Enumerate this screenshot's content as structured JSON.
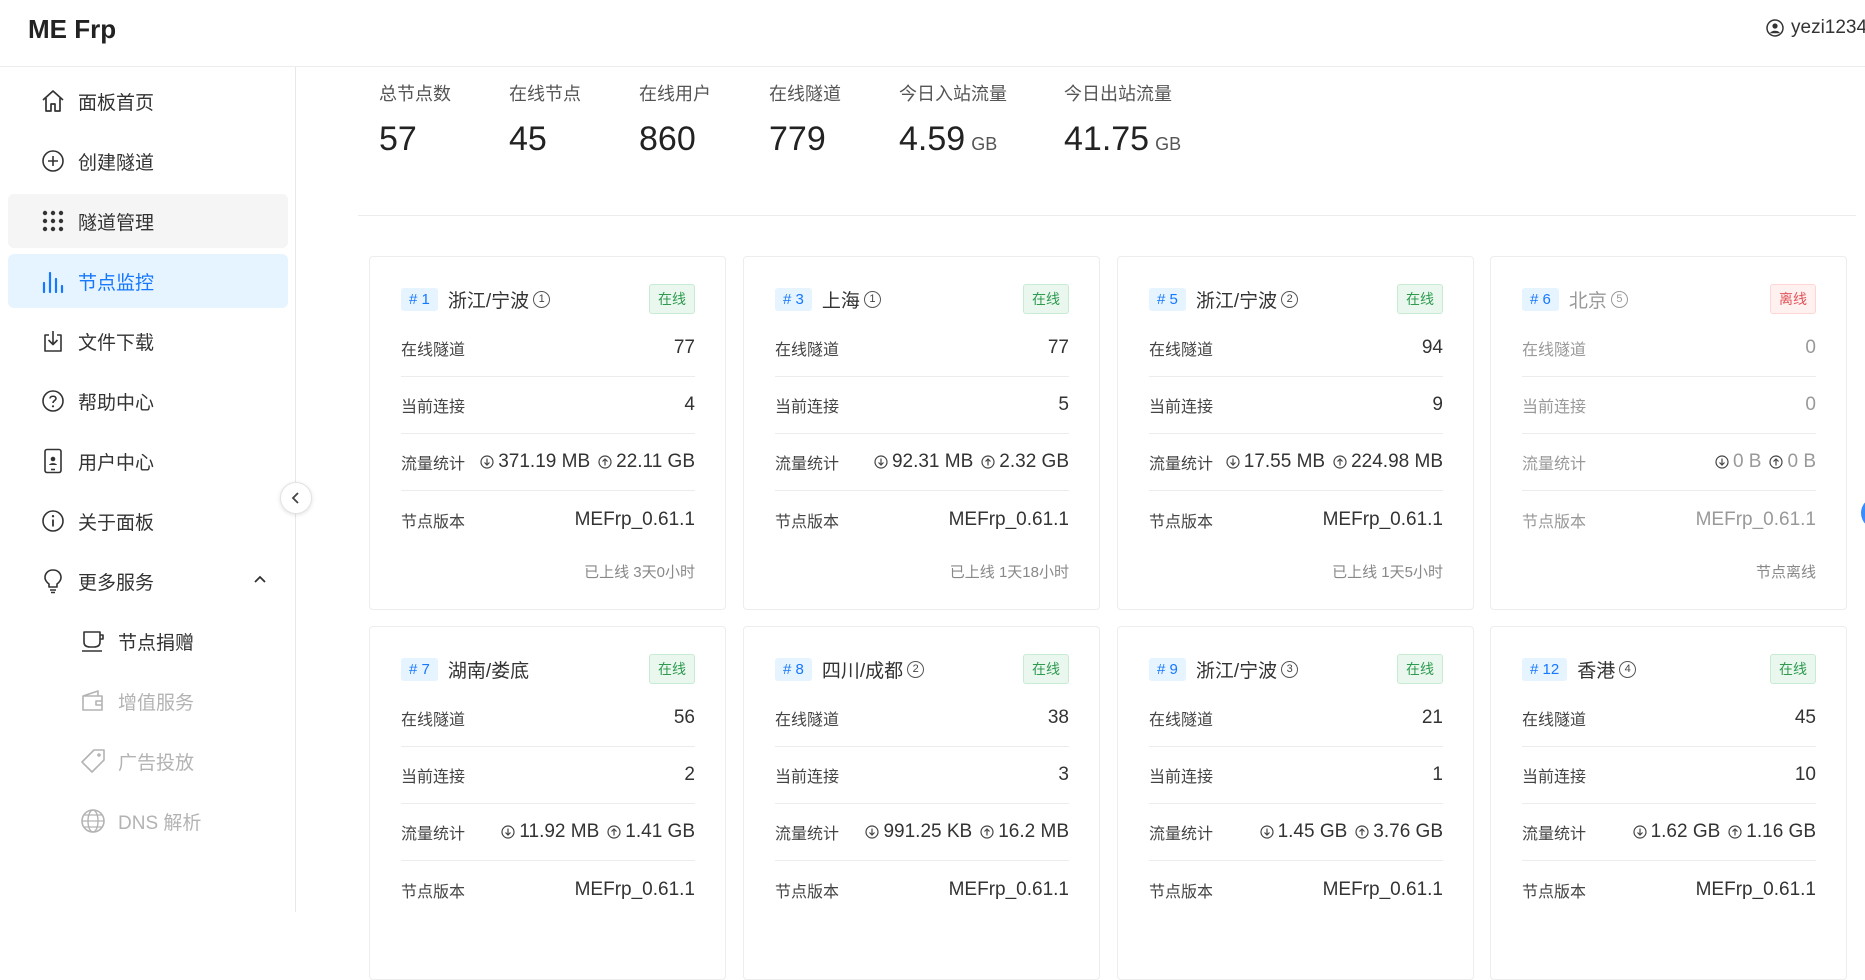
{
  "app": {
    "title": "ME Frp",
    "username": "yezi1234"
  },
  "sidebar": {
    "items": [
      {
        "label": "面板首页",
        "icon": "home-icon"
      },
      {
        "label": "创建隧道",
        "icon": "plus-circle-icon"
      },
      {
        "label": "隧道管理",
        "icon": "grid-dots-icon"
      },
      {
        "label": "节点监控",
        "icon": "bar-chart-icon"
      },
      {
        "label": "文件下载",
        "icon": "download-icon"
      },
      {
        "label": "帮助中心",
        "icon": "help-circle-icon"
      },
      {
        "label": "用户中心",
        "icon": "phone-user-icon"
      },
      {
        "label": "关于面板",
        "icon": "info-circle-icon"
      },
      {
        "label": "更多服务",
        "icon": "bulb-icon"
      }
    ],
    "subitems": [
      {
        "label": "节点捐赠",
        "icon": "cup-icon"
      },
      {
        "label": "增值服务",
        "icon": "wallet-icon"
      },
      {
        "label": "广告投放",
        "icon": "tag-icon"
      },
      {
        "label": "DNS 解析",
        "icon": "globe-icon"
      }
    ]
  },
  "stats": [
    {
      "label": "总节点数",
      "value": "57",
      "unit": ""
    },
    {
      "label": "在线节点",
      "value": "45",
      "unit": ""
    },
    {
      "label": "在线用户",
      "value": "860",
      "unit": ""
    },
    {
      "label": "在线隧道",
      "value": "779",
      "unit": ""
    },
    {
      "label": "今日入站流量",
      "value": "4.59",
      "unit": "GB"
    },
    {
      "label": "今日出站流量",
      "value": "41.75",
      "unit": "GB"
    }
  ],
  "row_labels": {
    "tunnels": "在线隧道",
    "connections": "当前连接",
    "traffic": "流量统计",
    "version": "节点版本"
  },
  "nodes": [
    {
      "id": "# 1",
      "name": "浙江/宁波",
      "badge": "1",
      "status": "在线",
      "tunnels": "77",
      "connections": "4",
      "down": "371.19 MB",
      "up": "22.11 GB",
      "version": "MEFrp_0.61.1",
      "uptime": "已上线 3天0小时"
    },
    {
      "id": "# 3",
      "name": "上海",
      "badge": "1",
      "status": "在线",
      "tunnels": "77",
      "connections": "5",
      "down": "92.31 MB",
      "up": "2.32 GB",
      "version": "MEFrp_0.61.1",
      "uptime": "已上线 1天18小时"
    },
    {
      "id": "# 5",
      "name": "浙江/宁波",
      "badge": "2",
      "status": "在线",
      "tunnels": "94",
      "connections": "9",
      "down": "17.55 MB",
      "up": "224.98 MB",
      "version": "MEFrp_0.61.1",
      "uptime": "已上线 1天5小时"
    },
    {
      "id": "# 6",
      "name": "北京",
      "badge": "5",
      "status": "离线",
      "tunnels": "0",
      "connections": "0",
      "down": "0 B",
      "up": "0 B",
      "version": "MEFrp_0.61.1",
      "uptime": "节点离线"
    },
    {
      "id": "# 7",
      "name": "湖南/娄底",
      "badge": "",
      "status": "在线",
      "tunnels": "56",
      "connections": "2",
      "down": "11.92 MB",
      "up": "1.41 GB",
      "version": "MEFrp_0.61.1",
      "uptime": ""
    },
    {
      "id": "# 8",
      "name": "四川/成都",
      "badge": "2",
      "status": "在线",
      "tunnels": "38",
      "connections": "3",
      "down": "991.25 KB",
      "up": "16.2 MB",
      "version": "MEFrp_0.61.1",
      "uptime": ""
    },
    {
      "id": "# 9",
      "name": "浙江/宁波",
      "badge": "3",
      "status": "在线",
      "tunnels": "21",
      "connections": "1",
      "down": "1.45 GB",
      "up": "3.76 GB",
      "version": "MEFrp_0.61.1",
      "uptime": ""
    },
    {
      "id": "# 12",
      "name": "香港",
      "badge": "4",
      "status": "在线",
      "tunnels": "45",
      "connections": "10",
      "down": "1.62 GB",
      "up": "1.16 GB",
      "version": "MEFrp_0.61.1",
      "uptime": ""
    }
  ]
}
